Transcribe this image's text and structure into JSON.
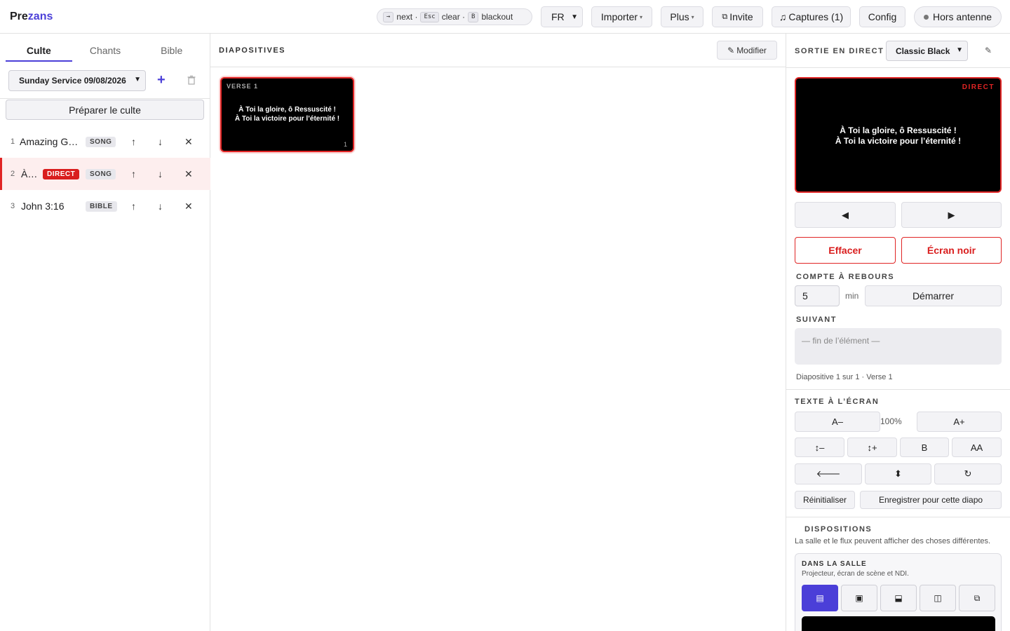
{
  "app": {
    "name_part1": "Pre",
    "name_part2": "zans"
  },
  "shortcuts": {
    "k1": "→",
    "t1": "next ·",
    "k2": "Esc",
    "t2": "clear ·",
    "k3": "B",
    "t3": "blackout"
  },
  "toolbar": {
    "lang": "FR",
    "import": "Importer",
    "more": "Plus",
    "invite": "Invite",
    "captures": "Captures (1)",
    "config": "Config",
    "status": "Hors antenne"
  },
  "left": {
    "tabs": [
      "Culte",
      "Chants",
      "Bible"
    ],
    "service": "Sunday Service 09/08/2026",
    "prepare": "Préparer le culte",
    "items": [
      {
        "num": "1",
        "title": "Amazing Grace",
        "type": "SONG",
        "live": false
      },
      {
        "num": "2",
        "title": "À Toi la gloire",
        "type": "SONG",
        "live": true,
        "badge": "DIRECT"
      },
      {
        "num": "3",
        "title": "John 3:16",
        "type": "BIBLE",
        "live": false
      }
    ]
  },
  "center": {
    "title": "DIAPOSITIVES",
    "edit": "Modifier",
    "slide": {
      "label": "VERSE 1",
      "line1": "À Toi la gloire, ô Ressuscité !",
      "line2": "À Toi la victoire pour l’éternité !",
      "number": "1"
    }
  },
  "right": {
    "title": "SORTIE EN DIRECT",
    "theme": "Classic Black",
    "preview": {
      "tag": "DIRECT",
      "line1": "À Toi la gloire, ô Ressuscité !",
      "line2": "À Toi la victoire pour l’éternité !"
    },
    "prev": "◀",
    "next": "▶",
    "clear": "Effacer",
    "black": "Écran noir",
    "countdown": {
      "title": "COMPTE À REBOURS",
      "value": "5",
      "unit": "min",
      "start": "Démarrer"
    },
    "upnext": {
      "title": "SUIVANT",
      "text": "— fin de l’élément —"
    },
    "info": "Diapositive 1 sur 1 · Verse 1",
    "text": {
      "title": "TEXTE À L’ÉCRAN",
      "smaller": "A–",
      "percent": "100%",
      "bigger": "A+",
      "lh_minus": "↕–",
      "lh_plus": "↕+",
      "bold": "B",
      "caps": "AA",
      "align_left": "🡐",
      "valign": "⬍",
      "reset_icon": "↻",
      "reset": "Réinitialiser",
      "save": "Enregistrer pour cette diapo"
    },
    "layouts": {
      "title": "DISPOSITIONS",
      "subtitle": "La salle et le flux peuvent afficher des choses différentes.",
      "room_title": "DANS LA SALLE",
      "room_sub": "Projecteur, écran de scène et NDI.",
      "icons": [
        "▤",
        "▣",
        "⬓",
        "◫",
        "⧉"
      ]
    }
  }
}
